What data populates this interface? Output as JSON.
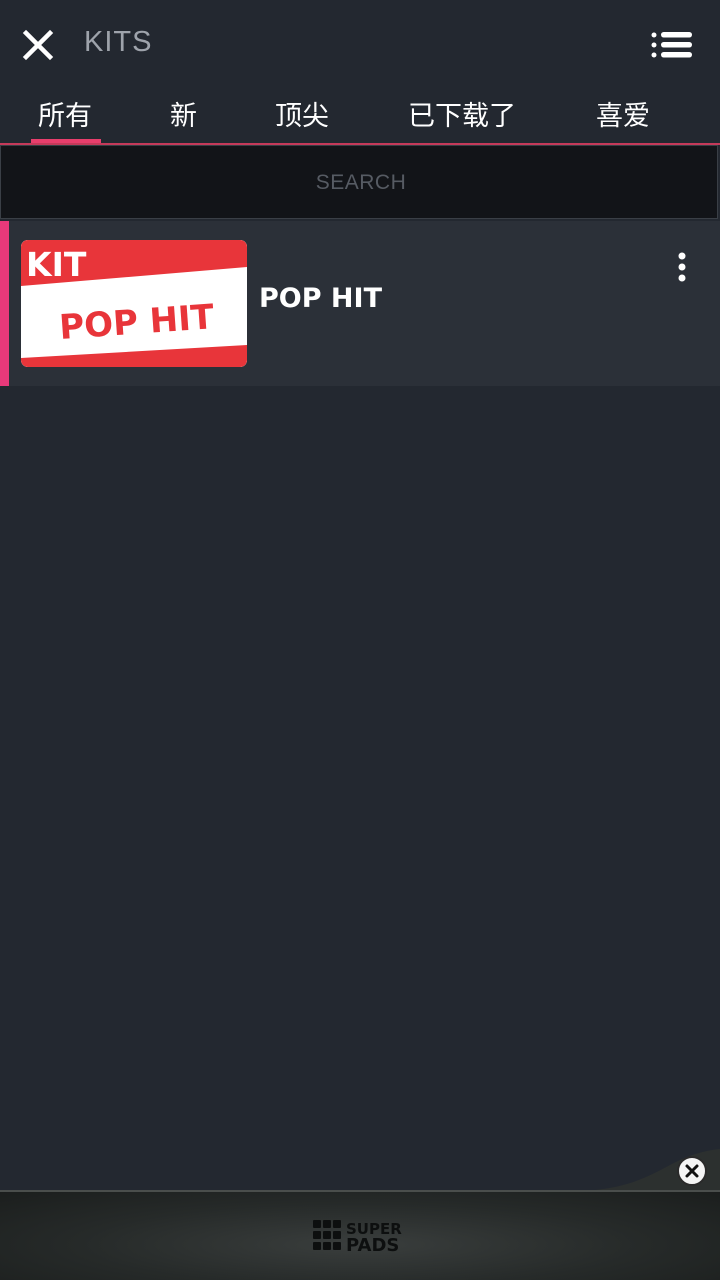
{
  "header": {
    "title": "KITS",
    "close_icon": "close-icon",
    "menu_icon": "list-menu-icon"
  },
  "tabs": [
    {
      "label": "所有",
      "selected": true
    },
    {
      "label": "新",
      "selected": false
    },
    {
      "label": "顶尖",
      "selected": false
    },
    {
      "label": "已下载了",
      "selected": false
    },
    {
      "label": "喜爱",
      "selected": false
    }
  ],
  "search": {
    "placeholder": "SEARCH",
    "value": ""
  },
  "kits": [
    {
      "name": "POP HIT",
      "thumbnail": {
        "top_text": "KIT",
        "main_text": "POP HIT"
      },
      "more_icon": "more-vertical-icon"
    }
  ],
  "ad": {
    "brand_line1": "SUPER",
    "brand_line2": "PADS",
    "close_icon": "close-icon"
  },
  "colors": {
    "background": "#232830",
    "accent": "#e8397a",
    "item_background": "#2b3038",
    "thumbnail_red": "#e8353a"
  }
}
